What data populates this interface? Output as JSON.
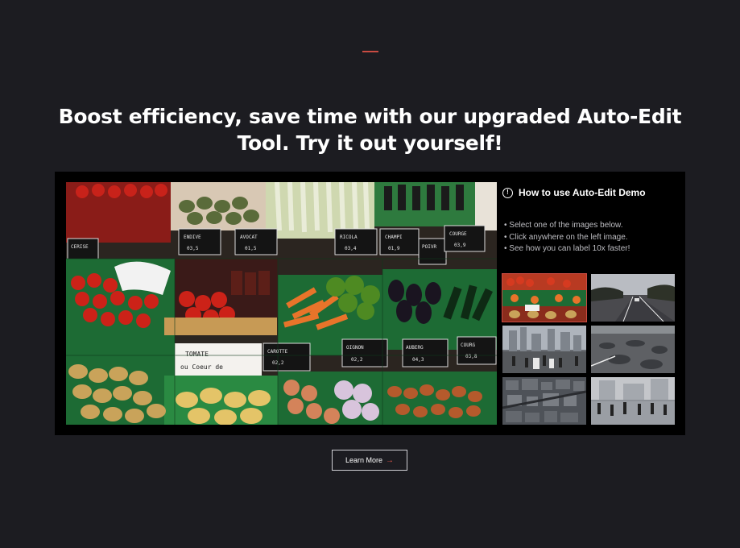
{
  "hero": {
    "headline": "Boost efficiency, save time with our upgraded Auto-Edit Tool. Try it out yourself!"
  },
  "demo": {
    "howto_title": "How to use Auto-Edit Demo",
    "steps": [
      "Select one of the images below.",
      "Click anywhere on the left image.",
      "See how you can label 10x faster!"
    ],
    "thumbnails": [
      {
        "name": "market-vegetables",
        "selected": true
      },
      {
        "name": "highway-road"
      },
      {
        "name": "city-street-crowd"
      },
      {
        "name": "potholed-road"
      },
      {
        "name": "aerial-city"
      },
      {
        "name": "pedestrian-square"
      }
    ]
  },
  "cta": {
    "learn_more": "Learn More",
    "arrow": "→"
  },
  "colors": {
    "background": "#1c1c21",
    "accent": "#c94b42",
    "frame": "#000000"
  }
}
